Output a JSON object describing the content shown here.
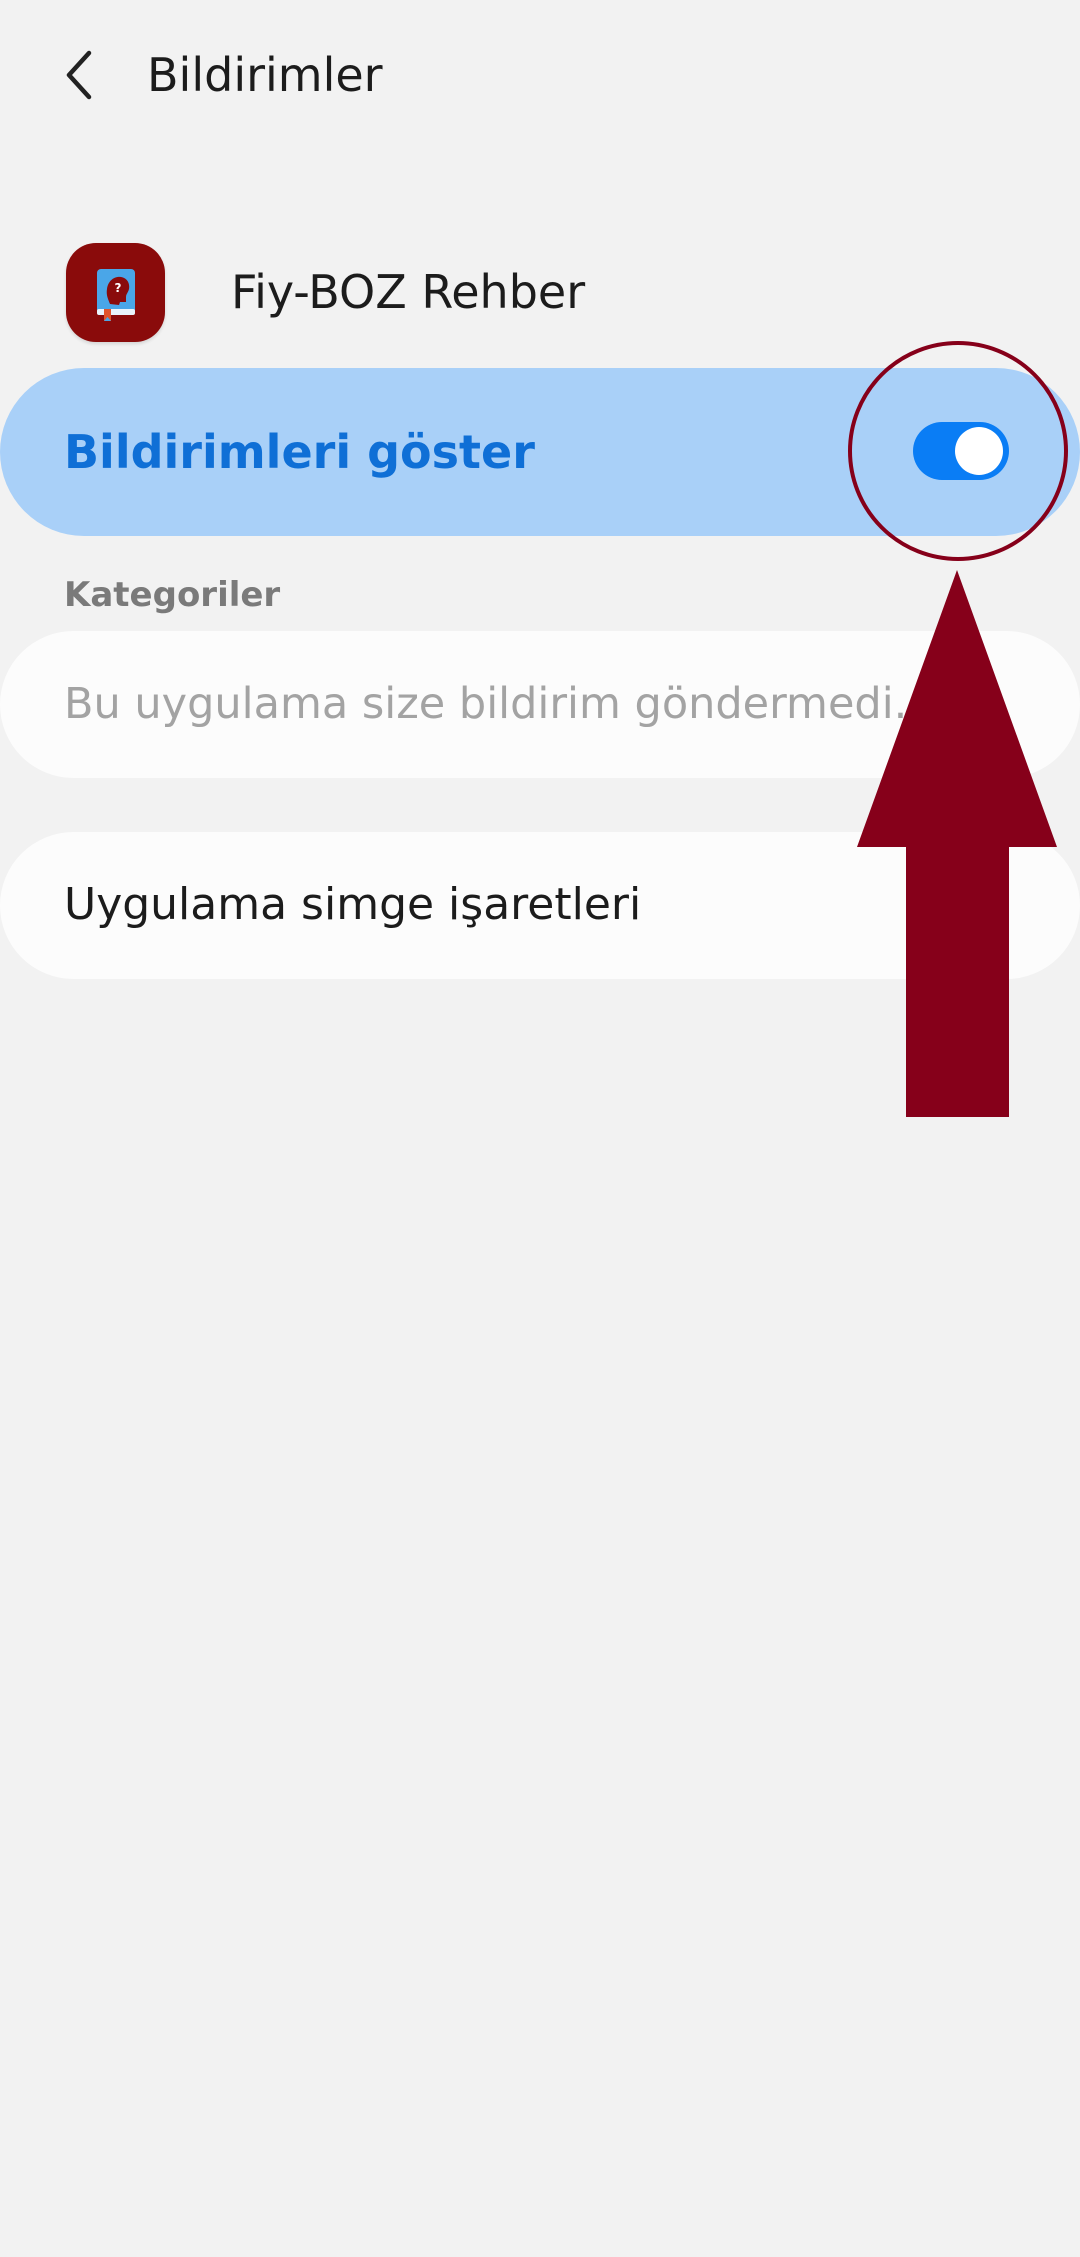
{
  "header": {
    "title": "Bildirimler",
    "back_icon": "chevron-left-icon"
  },
  "app": {
    "name": "Fiy-BOZ Rehber",
    "icon": "app-logo-icon",
    "icon_color": "#8a0b0b"
  },
  "master_toggle": {
    "label": "Bildirimleri göster",
    "state": "on",
    "accent_color": "#0a7df5",
    "card_color": "#a9d0f8"
  },
  "categories": {
    "header": "Kategoriler",
    "empty_message": "Bu uygulama size bildirim göndermedi."
  },
  "app_icon_badges": {
    "label": "Uygulama simge işaretleri"
  },
  "annotation": {
    "color": "#86001a",
    "shapes": [
      "circle",
      "up-arrow"
    ]
  }
}
